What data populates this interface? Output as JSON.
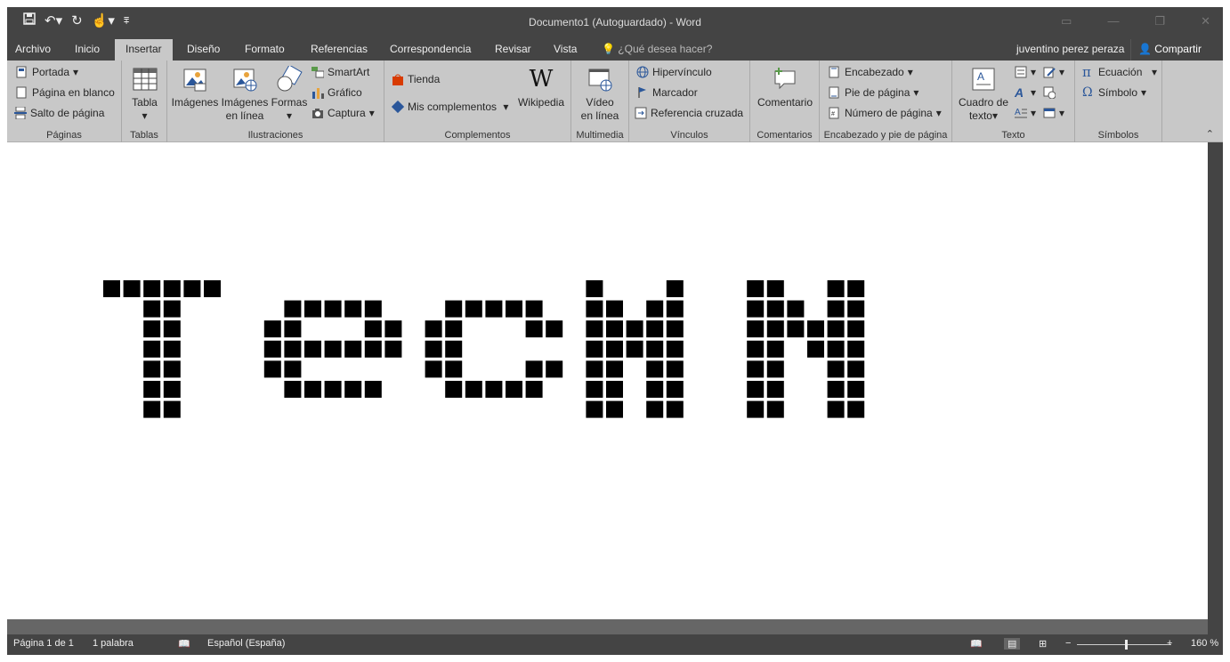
{
  "window": {
    "title": "Documento1 (Autoguardado) - Word"
  },
  "tabs": [
    {
      "label": "Archivo",
      "active": false
    },
    {
      "label": "Inicio",
      "active": false
    },
    {
      "label": "Insertar",
      "active": true
    },
    {
      "label": "Diseño",
      "active": false
    },
    {
      "label": "Formato",
      "active": false
    },
    {
      "label": "Referencias",
      "active": false
    },
    {
      "label": "Correspondencia",
      "active": false
    },
    {
      "label": "Revisar",
      "active": false
    },
    {
      "label": "Vista",
      "active": false
    }
  ],
  "tellme": {
    "placeholder": "¿Qué desea hacer?"
  },
  "user": {
    "name": "juventino perez peraza"
  },
  "share": {
    "label": "Compartir"
  },
  "ribbon": {
    "paginas": {
      "label": "Páginas",
      "portada": "Portada",
      "pagina_en_blanco": "Página en blanco",
      "salto": "Salto de página"
    },
    "tablas": {
      "label": "Tablas",
      "tabla": "Tabla"
    },
    "ilustraciones": {
      "label": "Ilustraciones",
      "imagenes": "Imágenes",
      "imagenes_linea_1": "Imágenes",
      "imagenes_linea_2": "en línea",
      "formas": "Formas",
      "smartart": "SmartArt",
      "grafico": "Gráfico",
      "captura": "Captura"
    },
    "complementos": {
      "label": "Complementos",
      "tienda": "Tienda",
      "mis": "Mis complementos",
      "wikipedia": "Wikipedia"
    },
    "multimedia": {
      "label": "Multimedia",
      "video_1": "Vídeo",
      "video_2": "en línea"
    },
    "vinculos": {
      "label": "Vínculos",
      "hipervinculo": "Hipervínculo",
      "marcador": "Marcador",
      "referencia": "Referencia cruzada"
    },
    "comentarios": {
      "label": "Comentarios",
      "comentario": "Comentario"
    },
    "encabezado": {
      "label": "Encabezado y pie de página",
      "encabezado": "Encabezado",
      "pie": "Pie de página",
      "numero": "Número de página"
    },
    "texto": {
      "label": "Texto",
      "cuadro_1": "Cuadro de",
      "cuadro_2": "texto"
    },
    "simbolos": {
      "label": "Símbolos",
      "ecuacion": "Ecuación",
      "simbolo": "Símbolo"
    }
  },
  "document": {
    "pixel_text": "TecMN"
  },
  "status": {
    "page": "Página 1 de 1",
    "words": "1 palabra",
    "language": "Español (España)",
    "zoom": "160 %"
  },
  "colors": {
    "titlebar": "#444444",
    "ribbon": "#c8c8c8",
    "document": "#ffffff",
    "pixel": "#000000"
  }
}
